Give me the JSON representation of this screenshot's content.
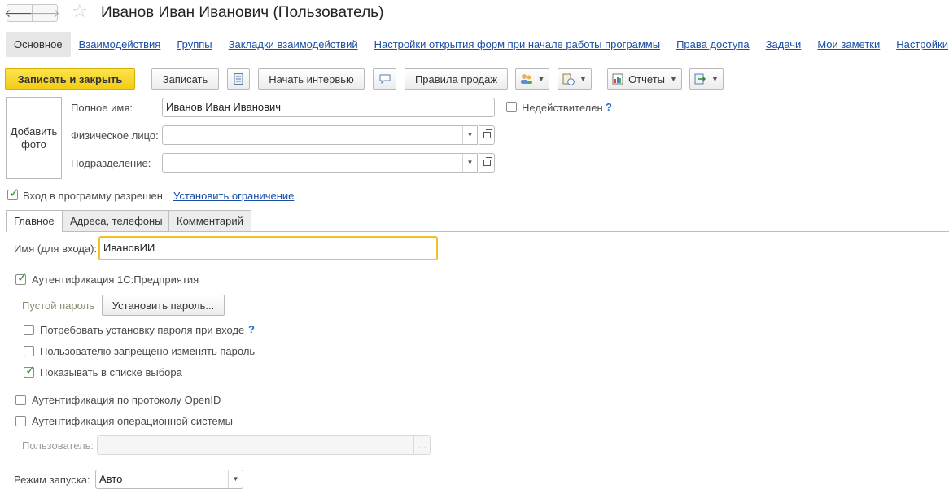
{
  "title": "Иванов Иван Иванович (Пользователь)",
  "nav": {
    "back_icon": "arrow-left-icon",
    "forward_icon": "arrow-right-icon",
    "favorite_icon": "star-icon"
  },
  "sections": {
    "active": "Основное",
    "links": [
      "Взаимодействия",
      "Группы",
      "Закладки взаимодействий",
      "Настройки открытия форм при начале работы программы",
      "Права доступа",
      "Задачи",
      "Мои заметки",
      "Настройки"
    ]
  },
  "toolbar": {
    "save_close": "Записать и закрыть",
    "save": "Записать",
    "start_interview": "Начать интервью",
    "sales_rules": "Правила продаж",
    "reports": "Отчеты"
  },
  "photo": {
    "label_line1": "Добавить",
    "label_line2": "фото"
  },
  "fields": {
    "full_name_label": "Полное имя:",
    "full_name_value": "Иванов Иван Иванович",
    "individual_label": "Физическое лицо:",
    "individual_value": "",
    "department_label": "Подразделение:",
    "department_value": "",
    "invalid_label": "Недействителен",
    "help": "?"
  },
  "login": {
    "allowed_label": "Вход в программу разрешен",
    "restriction_link": "Установить ограничение"
  },
  "tabs": [
    "Главное",
    "Адреса, телефоны",
    "Комментарий"
  ],
  "main_tab": {
    "login_name_label": "Имя (для входа):",
    "login_name_value": "ИвановИИ",
    "auth_1c_label": "Аутентификация 1С:Предприятия",
    "empty_password_label": "Пустой пароль",
    "set_password_button": "Установить пароль...",
    "require_password_label": "Потребовать установку пароля при входе",
    "forbid_change_label": "Пользователю запрещено изменять пароль",
    "show_in_list_label": "Показывать в списке выбора",
    "openid_label": "Аутентификация по протоколу OpenID",
    "os_auth_label": "Аутентификация операционной системы",
    "os_user_label": "Пользователь:",
    "os_user_value": "",
    "os_user_button": "...",
    "launch_mode_label": "Режим запуска:",
    "launch_mode_value": "Авто"
  },
  "checkbox_states": {
    "invalid": false,
    "login_allowed": true,
    "auth_1c": true,
    "require_password": false,
    "forbid_change": false,
    "show_in_list": true,
    "openid": false,
    "os_auth": false
  },
  "colors": {
    "accent_yellow": "#f3cc18",
    "link_blue": "#1c4fa3",
    "check_green": "#2e8b2e",
    "focus_border": "#f0c224"
  }
}
